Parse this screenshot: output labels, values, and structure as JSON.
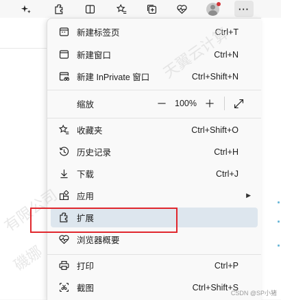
{
  "toolbar": {
    "buttons": [
      {
        "icon": "sparkle-icon"
      },
      {
        "icon": "extensions-icon"
      },
      {
        "icon": "split-screen-icon"
      },
      {
        "icon": "favorites-icon"
      },
      {
        "icon": "collections-icon"
      },
      {
        "icon": "browser-essentials-icon"
      },
      {
        "icon": "profile-icon"
      },
      {
        "icon": "more-icon",
        "label": "···"
      }
    ]
  },
  "menu": {
    "items": [
      {
        "label": "新建标签页",
        "shortcut": "Ctrl+T",
        "icon": "new-tab-icon"
      },
      {
        "label": "新建窗口",
        "shortcut": "Ctrl+N",
        "icon": "new-window-icon"
      },
      {
        "label": "新建 InPrivate 窗口",
        "shortcut": "Ctrl+Shift+N",
        "icon": "inprivate-icon"
      },
      {
        "label": "缩放",
        "icon": "none"
      },
      {
        "label": "收藏夹",
        "shortcut": "Ctrl+Shift+O",
        "icon": "favorites-icon"
      },
      {
        "label": "历史记录",
        "shortcut": "Ctrl+H",
        "icon": "history-icon"
      },
      {
        "label": "下载",
        "shortcut": "Ctrl+J",
        "icon": "download-icon"
      },
      {
        "label": "应用",
        "icon": "apps-icon",
        "submenu": "▶"
      },
      {
        "label": "扩展",
        "icon": "extensions-icon",
        "highlighted": true
      },
      {
        "label": "浏览器概要",
        "icon": "browser-essentials-icon"
      },
      {
        "label": "打印",
        "shortcut": "Ctrl+P",
        "icon": "print-icon"
      },
      {
        "label": "截图",
        "shortcut": "Ctrl+Shift+S",
        "icon": "screenshot-icon"
      }
    ],
    "zoom": {
      "minus": "—",
      "value": "100%",
      "plus": "+"
    }
  },
  "watermark": {
    "text1": "天翼云计算",
    "text2": "有限公司",
    "text3": "磯娜"
  },
  "credit": "CSDN @SP小猪",
  "colors": {
    "highlight": "#dde6ee",
    "annotation": "#e0252b",
    "notification": "#d13438"
  }
}
